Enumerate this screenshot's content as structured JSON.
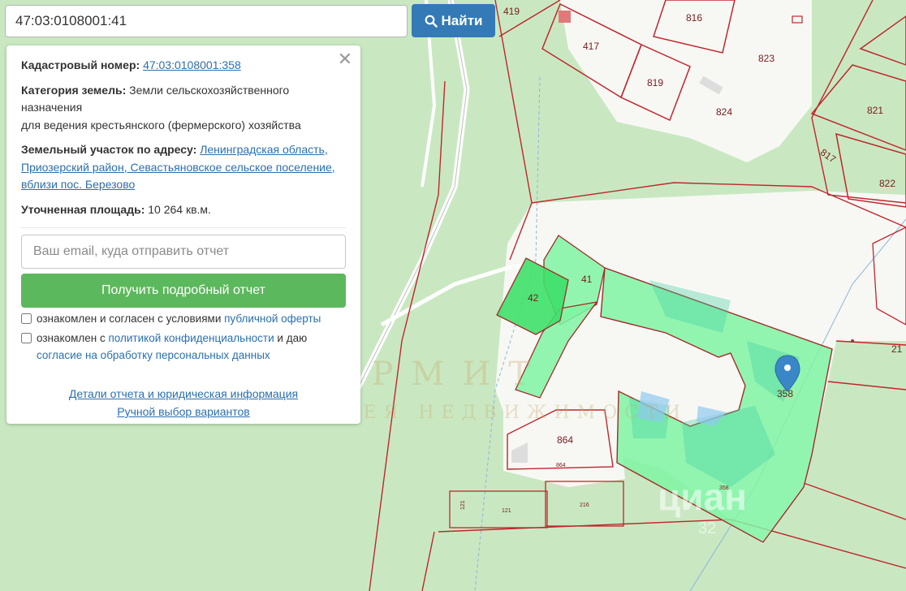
{
  "search": {
    "value": "47:03:0108001:41",
    "button_label": "Найти"
  },
  "info_panel": {
    "cadastral_label": "Кадастровый номер:",
    "cadastral_value": "47:03:0108001:358",
    "category_label": "Категория земель:",
    "category_value_line1": "Земли сельскохозяйственного назначения",
    "category_value_line2": "для ведения крестьянского (фермерского) хозяйства",
    "address_label": "Земельный участок по адресу:",
    "address_value": "Ленинградская область, Приозерский район, Севастьяновское сельское поселение, вблизи пос. Березово",
    "area_label": "Уточненная площадь:",
    "area_value": "10 264 кв.м.",
    "email_placeholder": "Ваш email, куда отправить отчет",
    "report_button": "Получить подробный отчет",
    "consent1_text": "ознакомлен и согласен с условиями",
    "consent1_link": "публичной оферты",
    "consent2_text_a": "ознакомлен с",
    "consent2_link_a": "политикой конфиденциальности",
    "consent2_text_b": "и даю",
    "consent2_link_b": "согласие на обработку персональных данных",
    "details_link": "Детали отчета и юридическая информация",
    "manual_link": "Ручной выбор вариантов"
  },
  "map_labels": {
    "p419": "419",
    "p417": "417",
    "p816": "816",
    "p823": "823",
    "p819": "819",
    "p824": "824",
    "p821": "821",
    "p817": "817",
    "p822": "822",
    "p42": "42",
    "p41": "41",
    "p358": "358",
    "p358_small": "358",
    "p864": "864",
    "p864_small": "864",
    "p121": "121",
    "p121_side": "121",
    "p216": "216",
    "p21": "21"
  },
  "watermarks": {
    "agency_name": "ЭРМИТ",
    "agency_sub": "ГАЛЕРЕЯ НЕДВИЖИМОСТИ",
    "site": "циан",
    "site_id": "32"
  },
  "colors": {
    "forest": "#c9e8c2",
    "clearing": "#f7f8f4",
    "parcel_border": "#c0262c",
    "selected_parcel": "#7ff5a3",
    "pin": "#3a87c8",
    "search_button": "#337ab7",
    "report_button": "#5cb85c"
  }
}
